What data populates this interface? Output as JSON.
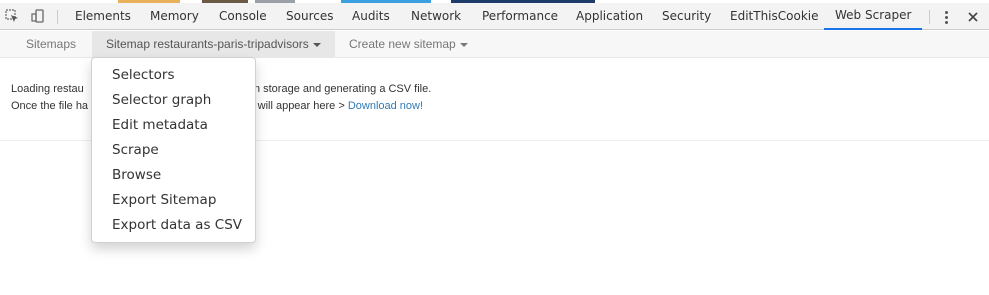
{
  "devtools": {
    "tabs": [
      {
        "label": "Elements",
        "active": false
      },
      {
        "label": "Memory",
        "active": false
      },
      {
        "label": "Console",
        "active": false
      },
      {
        "label": "Sources",
        "active": false
      },
      {
        "label": "Audits",
        "active": false
      },
      {
        "label": "Network",
        "active": false
      },
      {
        "label": "Performance",
        "active": false
      },
      {
        "label": "Application",
        "active": false
      },
      {
        "label": "Security",
        "active": false
      },
      {
        "label": "EditThisCookie",
        "active": false
      },
      {
        "label": "Web Scraper",
        "active": true
      }
    ],
    "icons": [
      "inspect-element-icon",
      "device-toolbar-icon",
      "more-options-icon",
      "close-icon"
    ],
    "accent_color": "#1a73e8"
  },
  "web_scraper": {
    "nav": {
      "sitemaps": "Sitemaps",
      "current_sitemap": "Sitemap restaurants-paris-tripadvisors",
      "create_new": "Create new sitemap"
    },
    "dropdown": {
      "items": [
        "Selectors",
        "Selector graph",
        "Edit metadata",
        "Scrape",
        "Browse",
        "Export Sitemap",
        "Export data as CSV"
      ]
    },
    "content": {
      "line1_start": "Loading restau",
      "line1_end": "om storage and generating a CSV file.",
      "line2_start": "Once the file ha",
      "line2_end": "link will appear here > ",
      "download_link": "Download now!",
      "link_color": "#337ab7"
    }
  }
}
